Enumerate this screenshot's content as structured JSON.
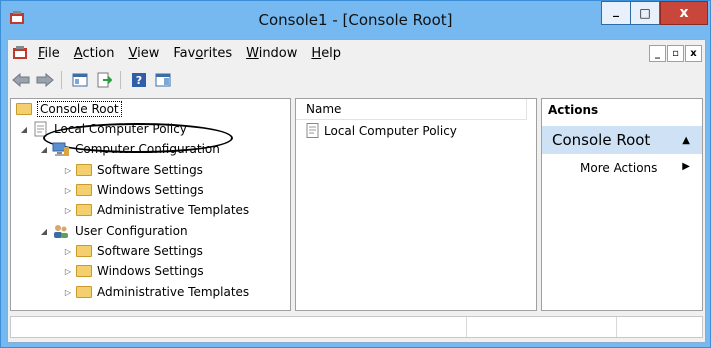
{
  "window": {
    "title": "Console1 - [Console Root]"
  },
  "titlebar_buttons": {
    "minimize": "_",
    "maximize": "□",
    "close": "x"
  },
  "menubar": {
    "items": [
      {
        "label": "File",
        "accel": "F",
        "rest": "ile"
      },
      {
        "label": "Action",
        "accel": "A",
        "rest": "ction"
      },
      {
        "label": "View",
        "accel": "V",
        "rest": "iew"
      },
      {
        "label": "Favorites",
        "pre": "Fav",
        "accel": "o",
        "rest": "rites"
      },
      {
        "label": "Window",
        "accel": "W",
        "rest": "indow"
      },
      {
        "label": "Help",
        "accel": "H",
        "rest": "elp"
      }
    ],
    "mdi_buttons": [
      "_",
      "▫",
      "x"
    ]
  },
  "tree": {
    "root": "Console Root",
    "local_policy": "Local Computer Policy",
    "computer_config": "Computer Configuration",
    "cc_children": [
      "Software Settings",
      "Windows Settings",
      "Administrative Templates"
    ],
    "user_config": "User Configuration",
    "uc_children": [
      "Software Settings",
      "Windows Settings",
      "Administrative Templates"
    ]
  },
  "list": {
    "column": "Name",
    "items": [
      "Local Computer Policy"
    ]
  },
  "actions": {
    "title": "Actions",
    "section": "Console Root",
    "item": "More Actions"
  },
  "colors": {
    "titlebar": "#76b8f0",
    "close_button": "#c9473a",
    "action_section": "#cfe2f5",
    "folder": "#f3cf6d"
  }
}
